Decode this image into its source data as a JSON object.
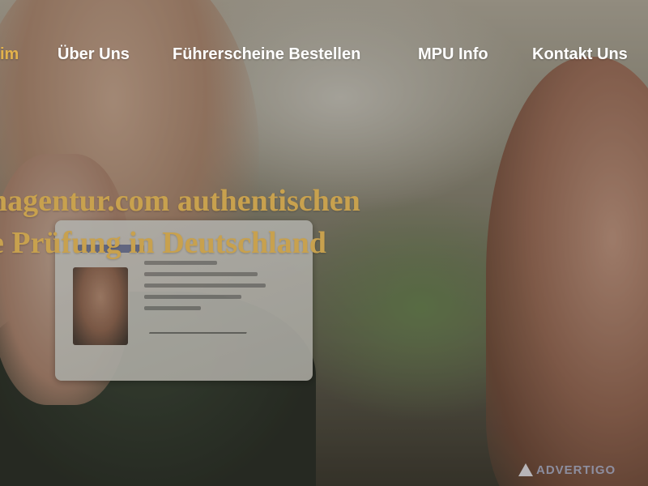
{
  "nav": {
    "items": [
      {
        "label": "im",
        "active": true
      },
      {
        "label": "Über Uns",
        "active": false
      },
      {
        "label": "Führerscheine Bestellen",
        "active": false
      },
      {
        "label": "MPU Info",
        "active": false
      },
      {
        "label": "Kontakt Uns",
        "active": false
      }
    ]
  },
  "hero": {
    "headline_line1": "nagentur.com authentischen",
    "headline_line2": "e Prüfung in Deutschland"
  },
  "watermark": {
    "text": "ADVERTIGO",
    "icon": "triangle-logo-icon"
  },
  "colors": {
    "nav_text": "#ffffff",
    "nav_active": "#e3b24c",
    "headline": "#c8a14e"
  }
}
